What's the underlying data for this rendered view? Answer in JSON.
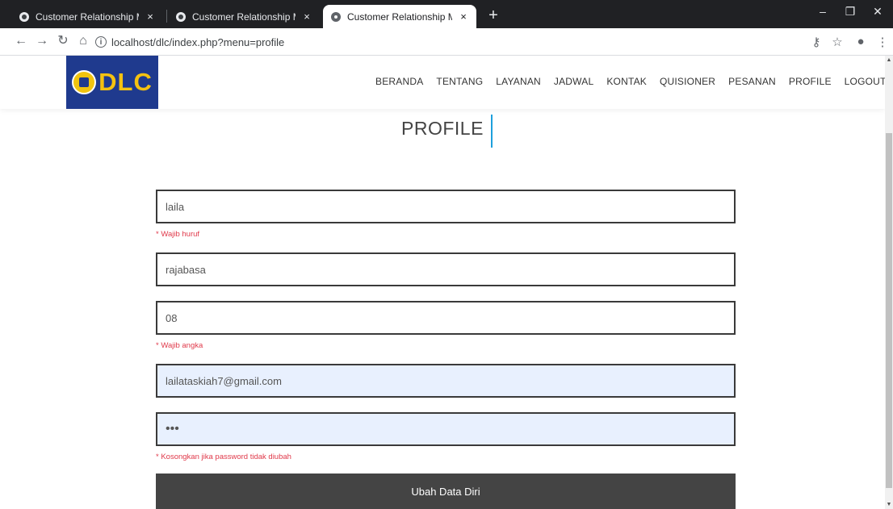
{
  "browser": {
    "tabs": [
      {
        "title": "Customer Relationship Managem",
        "close": "×",
        "active": false
      },
      {
        "title": "Customer Relationship Managem",
        "close": "×",
        "active": false
      },
      {
        "title": "Customer Relationship Managem",
        "close": "×",
        "active": true
      }
    ],
    "new_tab": "+",
    "window_controls": {
      "minimize": "–",
      "restore": "❐",
      "close": "✕"
    },
    "nav": {
      "back": "←",
      "forward": "→",
      "reload": "↻",
      "home": "⌂"
    },
    "url": "localhost/dlc/index.php?menu=profile",
    "toolbar_icons": {
      "key": "⚷",
      "star": "☆",
      "account": "●",
      "menu": "⋮"
    }
  },
  "site": {
    "logo_text": "DLC",
    "nav": [
      "BERANDA",
      "TENTANG",
      "LAYANAN",
      "JADWAL",
      "KONTAK",
      "QUISIONER",
      "PESANAN",
      "PROFILE",
      "LOGOUT"
    ]
  },
  "page": {
    "title": "PROFILE",
    "form": {
      "name": {
        "value": "laila",
        "hint": "* Wajib huruf"
      },
      "address": {
        "value": "rajabasa"
      },
      "phone": {
        "value": "08",
        "hint": "* Wajib angka"
      },
      "email": {
        "value": "lailataskiah7@gmail.com"
      },
      "password": {
        "value": "•••",
        "hint": "* Kosongkan jika password tidak diubah"
      },
      "submit_label": "Ubah Data Diri"
    }
  },
  "colors": {
    "accent": "#1ea0dc",
    "hint": "#e0394a",
    "button": "#444444",
    "logo_bg": "#1f3a8e",
    "logo_text": "#f5c211"
  }
}
